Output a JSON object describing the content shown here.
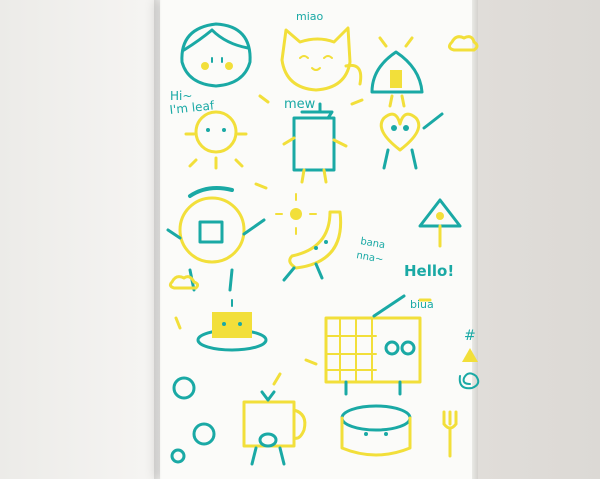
{
  "colors": {
    "teal": "#1aa9a5",
    "yellow": "#f2df3a",
    "paper": "#fbfbf9"
  },
  "labels": {
    "miao": "miao",
    "hi": "Hi~",
    "im_leaf": "I'm leaf",
    "mew": "mew",
    "bana": "bana",
    "nna": "nna~",
    "hello": "Hello!",
    "biua": "biua",
    "hash": "#"
  }
}
